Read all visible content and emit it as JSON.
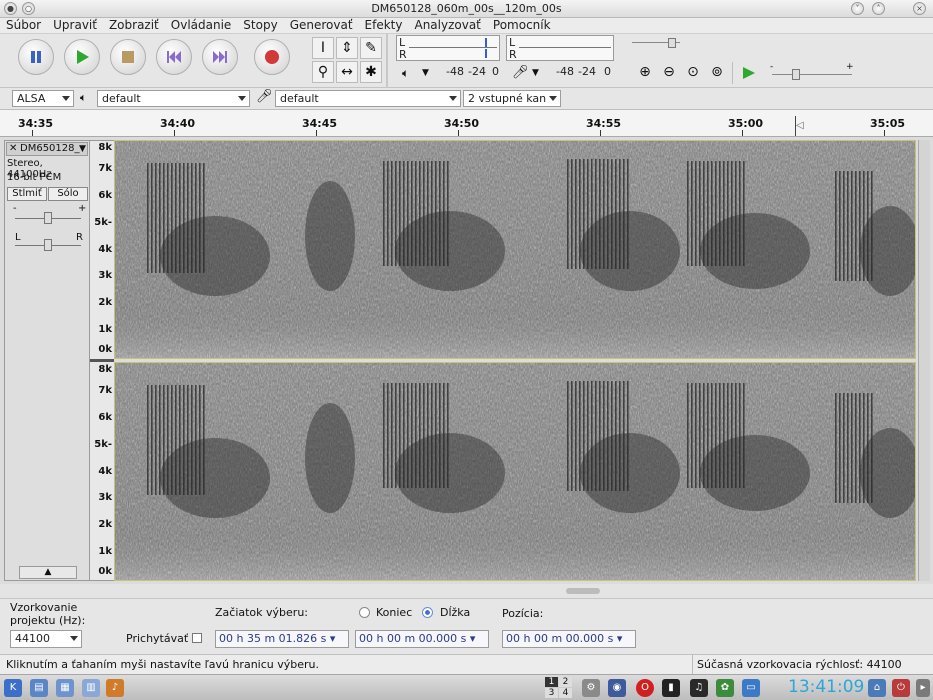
{
  "window": {
    "title": "DM650128_060m_00s__120m_00s"
  },
  "menu": {
    "items": [
      "Súbor",
      "Upraviť",
      "Zobraziť",
      "Ovládanie",
      "Stopy",
      "Generovať",
      "Efekty",
      "Analyzovať",
      "Pomocník"
    ]
  },
  "meters": {
    "play_channels": [
      "L",
      "R"
    ],
    "rec_channels": [
      "L",
      "R"
    ],
    "play_scale": [
      "-48",
      "-24",
      "0"
    ],
    "rec_scale": [
      "-48",
      "-24",
      "0"
    ]
  },
  "devices": {
    "host": "ALSA",
    "output": "default",
    "input": "default",
    "channels": "2 vstupné kan"
  },
  "timeline": {
    "ticks": [
      "34:35",
      "34:40",
      "34:45",
      "34:50",
      "34:55",
      "35:00",
      "35:05"
    ]
  },
  "track": {
    "name": "DM650128_",
    "format": "Stereo, 44100Hz",
    "bit_depth": "16-bit PCM",
    "mute_label": "Stlmiť",
    "solo_label": "Sólo",
    "gain_minus": "-",
    "gain_plus": "+",
    "pan_left": "L",
    "pan_right": "R",
    "freq_labels": [
      "8k",
      "7k",
      "6k",
      "5k-",
      "4k",
      "3k",
      "2k",
      "1k",
      "0k"
    ]
  },
  "selection": {
    "rate_label_1": "Vzorkovanie",
    "rate_label_2": "projektu (Hz):",
    "rate_value": "44100",
    "snap_label": "Prichytávať",
    "start_label": "Začiatok výberu:",
    "end_label": "Koniec",
    "length_label": "Dĺžka",
    "position_label": "Pozícia:",
    "start_value": "00 h 35 m 01.826 s",
    "length_value": "00 h 00 m 00.000 s",
    "position_value": "00 h 00 m 00.000 s"
  },
  "status": {
    "hint": "Kliknutím a ťahaním myši nastavíte ľavú hranicu výberu.",
    "rate": "Súčasná vzorkovacia rýchlosť: 44100"
  },
  "taskbar": {
    "clock": "13:41:09",
    "desk_top": [
      "1",
      "2"
    ],
    "desk_bottom": [
      "3",
      "4"
    ]
  },
  "colors": {
    "play": "#2ea82e",
    "record": "#d23a3a",
    "pause": "#3a63c8",
    "accent_clock": "#2aa7d8"
  }
}
